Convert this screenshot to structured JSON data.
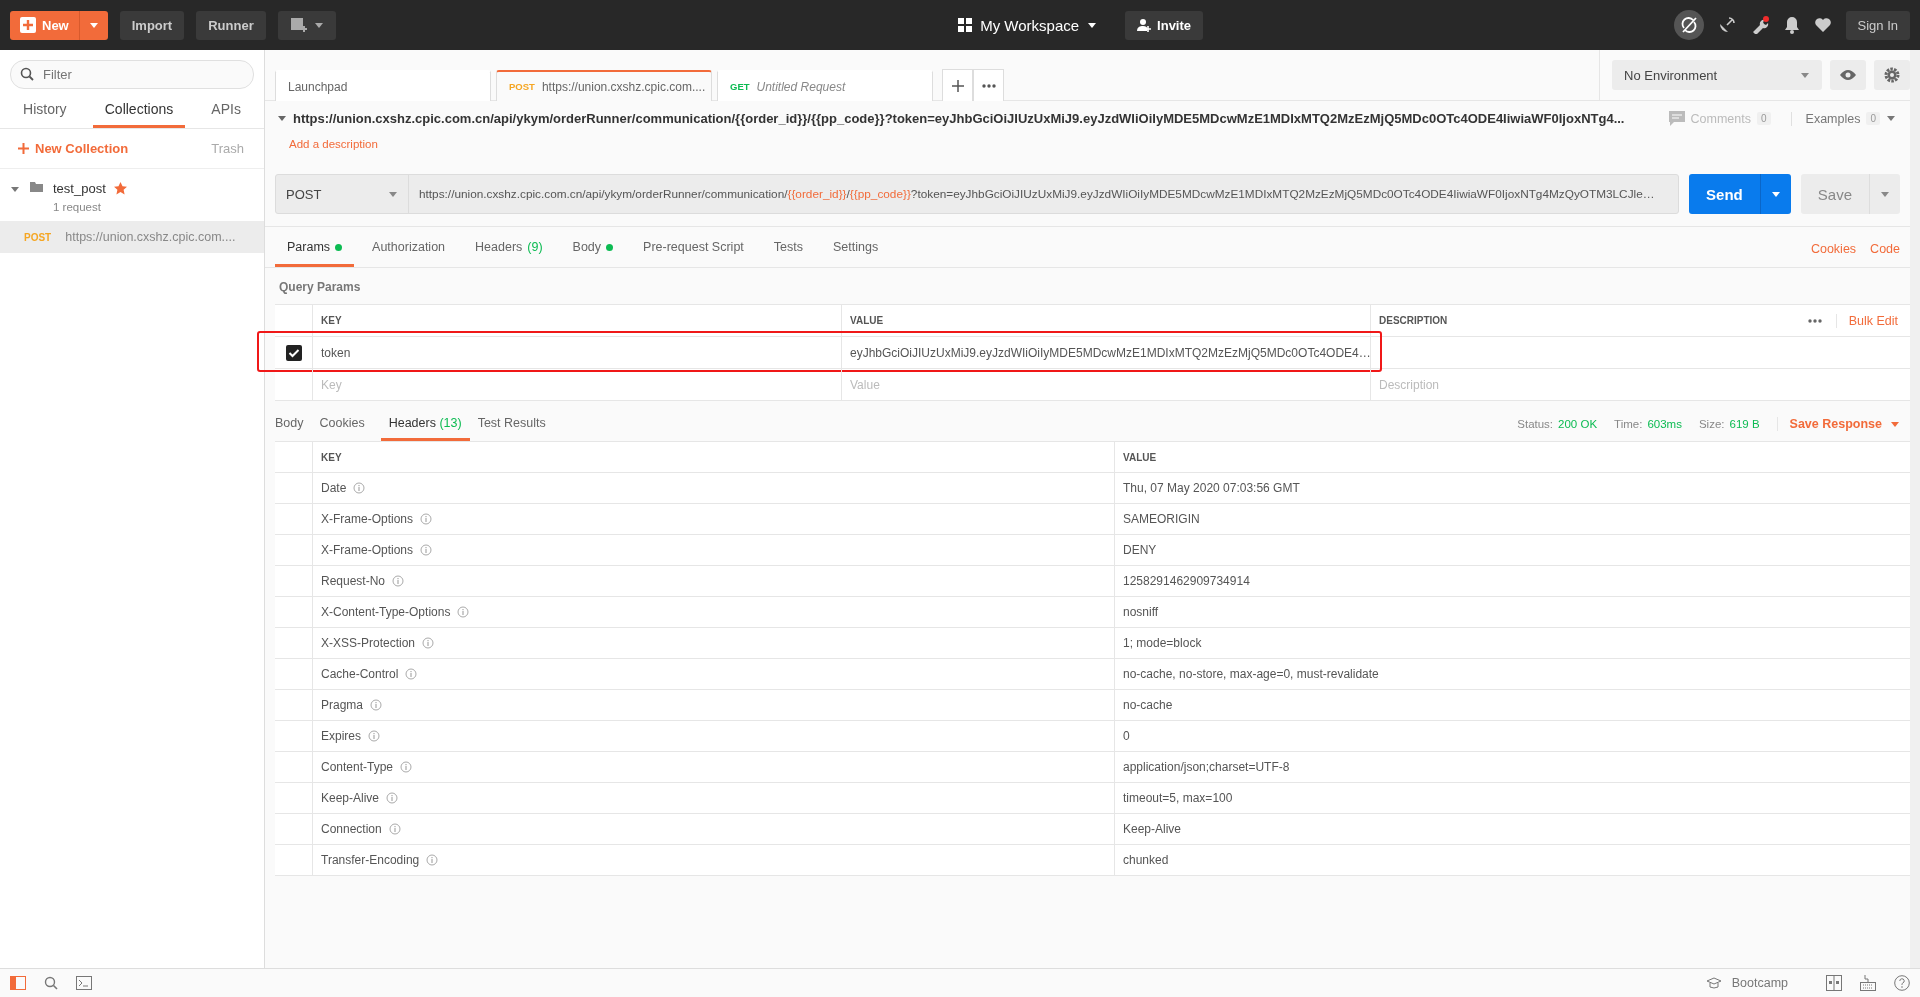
{
  "topbar": {
    "new_label": "New",
    "import_label": "Import",
    "runner_label": "Runner",
    "workspace": "My Workspace",
    "invite": "Invite",
    "sign_in": "Sign In"
  },
  "sidebar": {
    "filter_placeholder": "Filter",
    "tabs": [
      {
        "label": "History",
        "selected": false
      },
      {
        "label": "Collections",
        "selected": true
      },
      {
        "label": "APIs",
        "selected": false
      }
    ],
    "new_collection": "New Collection",
    "trash": "Trash",
    "collections": [
      {
        "name": "test_post",
        "starred": true,
        "expanded": true,
        "count": "1 request",
        "children": [
          {
            "method": "POST",
            "name": "https://union.cxshz.cpic.com....",
            "selected": true
          }
        ]
      }
    ]
  },
  "request_tabs": [
    {
      "label": "Launchpad",
      "selected": false
    },
    {
      "method": "POST",
      "label": "https://union.cxshz.cpic.com....",
      "selected": true,
      "unsaved": false
    },
    {
      "method": "GET",
      "label": "Untitled Request",
      "selected": false,
      "unsaved": true
    }
  ],
  "environment": {
    "selected": "No Environment"
  },
  "request": {
    "title": "https://union.cxshz.cpic.com.cn/api/ykym/orderRunner/communication/{{order_id}}/{{pp_code}}?token=eyJhbGciOiJIUzUxMiJ9.eyJzdWIiOiIyMDE5MDcwMzE1MDIxMTQ2MzEzMjQ5MDc0OTc4ODE4IiwiaWF0IjoxNTg4...",
    "expanded": true,
    "comments_label": "Comments",
    "comments_count": "0",
    "examples_label": "Examples",
    "examples_count": "0",
    "add_description": "Add a description",
    "method": "POST",
    "url_parts": [
      {
        "kind": "plain",
        "text": "https://union.cxshz.cpic.com.cn/api/ykym/orderRunner/communication/"
      },
      {
        "kind": "variable",
        "text": "{{order_id}}"
      },
      {
        "kind": "plain",
        "text": "/"
      },
      {
        "kind": "variable",
        "text": "{{pp_code}}"
      },
      {
        "kind": "plain",
        "text": "?token=eyJhbGciOiJIUzUxMiJ9.eyJzdWIiOiIyMDE5MDcwMzE1MDIxMTQ2MzEzMjQ5MDc0OTc4ODE4IiwiaWF0IjoxNTg4MzQyOTM3LCJle…"
      }
    ],
    "send": "Send",
    "save": "Save"
  },
  "sections": [
    {
      "label": "Params",
      "dot": true,
      "selected": true
    },
    {
      "label": "Authorization",
      "dot": false,
      "selected": false
    },
    {
      "label": "Headers",
      "count": "(9)",
      "dot": false,
      "selected": false
    },
    {
      "label": "Body",
      "dot": true,
      "selected": false
    },
    {
      "label": "Pre-request Script",
      "dot": false,
      "selected": false
    },
    {
      "label": "Tests",
      "dot": false,
      "selected": false
    },
    {
      "label": "Settings",
      "dot": false,
      "selected": false
    }
  ],
  "section_links": [
    "Cookies",
    "Code"
  ],
  "params": {
    "title": "Query Params",
    "columns": [
      "KEY",
      "VALUE",
      "DESCRIPTION"
    ],
    "bulk_edit": "Bulk Edit",
    "rows": [
      {
        "checked": true,
        "highlighted": true,
        "key": "token",
        "value": "eyJhbGciOiJIUzUxMiJ9.eyJzdWIiOiIyMDE5MDcwMzE1MDIxMTQ2MzEzMjQ5MDc0OTc4ODE4…"
      }
    ],
    "new_row": {
      "key": {
        "placeholder": "Key"
      },
      "value": {
        "placeholder": "Value"
      },
      "description": {
        "placeholder": "Description"
      }
    }
  },
  "response": {
    "tabs": [
      {
        "label": "Body",
        "selected": false
      },
      {
        "label": "Cookies",
        "selected": false
      },
      {
        "label": "Headers",
        "count": "(13)",
        "selected": true
      },
      {
        "label": "Test Results",
        "selected": false
      }
    ],
    "status_label": "Status:",
    "status": "200 OK",
    "time_label": "Time:",
    "time": "603ms",
    "size_label": "Size:",
    "size": "619 B",
    "save_response": "Save Response",
    "columns": [
      "KEY",
      "VALUE"
    ],
    "headers": [
      {
        "key": "Date",
        "value": "Thu, 07 May 2020 07:03:56 GMT"
      },
      {
        "key": "X-Frame-Options",
        "value": "SAMEORIGIN"
      },
      {
        "key": "X-Frame-Options",
        "value": "DENY"
      },
      {
        "key": "Request-No",
        "value": "1258291462909734914"
      },
      {
        "key": "X-Content-Type-Options",
        "value": "nosniff"
      },
      {
        "key": "X-XSS-Protection",
        "value": "1; mode=block"
      },
      {
        "key": "Cache-Control",
        "value": "no-cache, no-store, max-age=0, must-revalidate"
      },
      {
        "key": "Pragma",
        "value": "no-cache"
      },
      {
        "key": "Expires",
        "value": "0"
      },
      {
        "key": "Content-Type",
        "value": "application/json;charset=UTF-8"
      },
      {
        "key": "Keep-Alive",
        "value": "timeout=5, max=100"
      },
      {
        "key": "Connection",
        "value": "Keep-Alive"
      },
      {
        "key": "Transfer-Encoding",
        "value": "chunked"
      }
    ]
  },
  "statusbar": {
    "bootcamp": "Bootcamp"
  }
}
